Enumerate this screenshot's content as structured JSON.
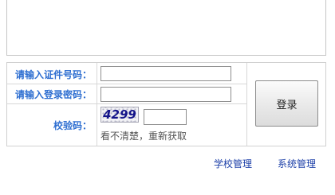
{
  "login_form": {
    "id_label": "请输入证件号码：",
    "id_value": "",
    "password_label": "请输入登录密码：",
    "password_value": "",
    "captcha_label": "校验码：",
    "captcha_image_text": "4299",
    "captcha_value": "",
    "captcha_refresh_text": "看不清楚，重新获取",
    "login_button_label": "登录"
  },
  "footer": {
    "links": [
      {
        "label": "学校管理"
      },
      {
        "label": "系统管理"
      }
    ]
  },
  "colors": {
    "label_blue": "#2f6fd1",
    "link_blue": "#1c3fa8",
    "captcha_text": "#14148a"
  }
}
